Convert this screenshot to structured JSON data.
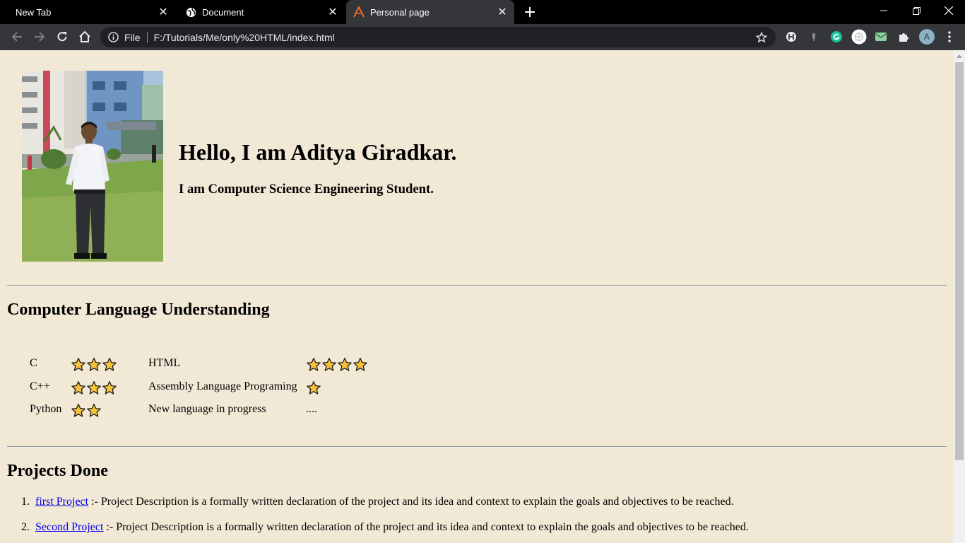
{
  "browser": {
    "tabs": [
      {
        "title": "New Tab",
        "favicon": "none"
      },
      {
        "title": "Document",
        "favicon": "globe-icon"
      },
      {
        "title": "Personal page",
        "favicon": "a-logo-icon",
        "active": true
      }
    ],
    "omnibox": {
      "scheme_label": "File",
      "url": "F:/Tutorials/Me/only%20HTML/index.html"
    },
    "profile_initial": "A"
  },
  "page": {
    "hero": {
      "title": "Hello, I am Aditya Giradkar.",
      "subtitle": "I am Computer Science Engineering Student."
    },
    "languages_section": {
      "title": "Computer Language Understanding",
      "rows": [
        {
          "name": "C",
          "stars": 3,
          "name2": "HTML",
          "stars2": 4
        },
        {
          "name": "C++",
          "stars": 3,
          "name2": "Assembly Language Programing",
          "stars2": 1
        },
        {
          "name": "Python",
          "stars": 2,
          "name2": "New language in progress",
          "stars2_text": "...."
        }
      ]
    },
    "projects_section": {
      "title": "Projects Done",
      "items": [
        {
          "number": "1.",
          "link": "first Project",
          "description": " :- Project Description is a formally written declaration of the project and its idea and context to explain the goals and objectives to be reached."
        },
        {
          "number": "2.",
          "link": "Second Project",
          "description": " :- Project Description is a formally written declaration of the project and its idea and context to explain the goals and objectives to be reached."
        }
      ]
    }
  }
}
